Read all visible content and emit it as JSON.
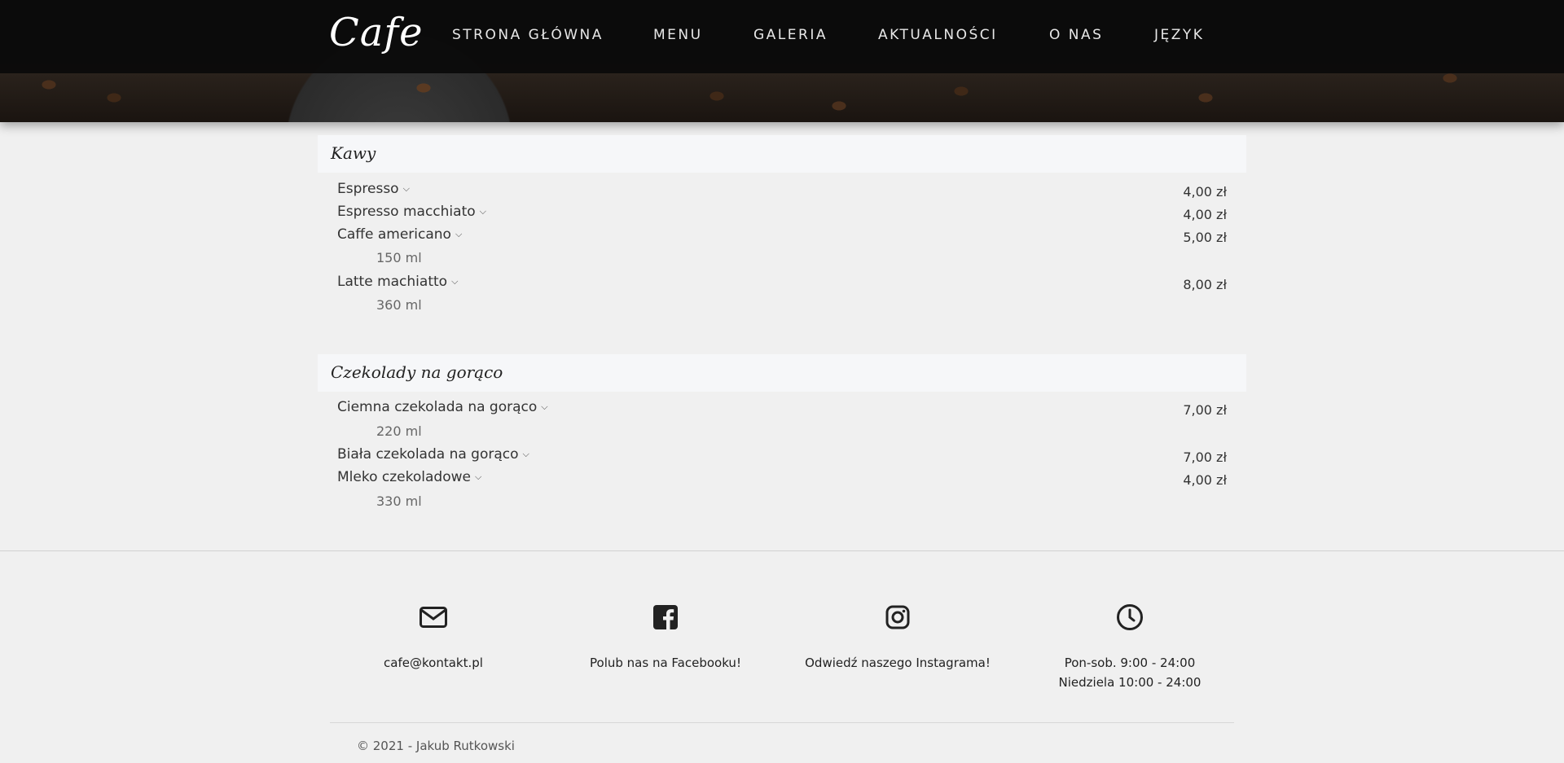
{
  "header": {
    "logo": "Cafe",
    "nav": [
      {
        "label": "STRONA GŁÓWNA"
      },
      {
        "label": "MENU"
      },
      {
        "label": "GALERIA"
      },
      {
        "label": "AKTUALNOŚCI"
      },
      {
        "label": "O NAS"
      },
      {
        "label": "JĘZYK"
      }
    ]
  },
  "menu": {
    "sections": [
      {
        "title": "Kawy",
        "items": [
          {
            "name": "Espresso",
            "price": "4,00 zł"
          },
          {
            "name": "Espresso macchiato",
            "price": "4,00 zł"
          },
          {
            "name": "Caffe americano",
            "price": "5,00 zł",
            "size": "150 ml"
          },
          {
            "name": "Latte machiatto",
            "price": "8,00 zł",
            "size": "360 ml"
          }
        ]
      },
      {
        "title": "Czekolady na gorąco",
        "items": [
          {
            "name": "Ciemna czekolada na gorąco",
            "price": "7,00 zł",
            "size": "220 ml"
          },
          {
            "name": "Biała czekolada na gorąco",
            "price": "7,00 zł"
          },
          {
            "name": "Mleko czekoladowe",
            "price": "4,00 zł",
            "size": "330 ml"
          }
        ]
      }
    ]
  },
  "footer": {
    "email": "cafe@kontakt.pl",
    "facebook": "Polub nas na Facebooku!",
    "instagram": "Odwiedź naszego Instagrama!",
    "hours": [
      "Pon-sob. 9:00 - 24:00",
      "Niedziela 10:00 - 24:00"
    ],
    "copyright": "© 2021 - Jakub Rutkowski"
  },
  "icons": {
    "dropdown": "chevron-down-icon",
    "email": "envelope-icon",
    "facebook": "facebook-icon",
    "instagram": "instagram-icon",
    "hours": "clock-icon"
  },
  "colors": {
    "navbar": "#0a0a0a",
    "page_background": "#f0f0f0",
    "section_header": "#f6f7f9",
    "icon": "#222222"
  }
}
